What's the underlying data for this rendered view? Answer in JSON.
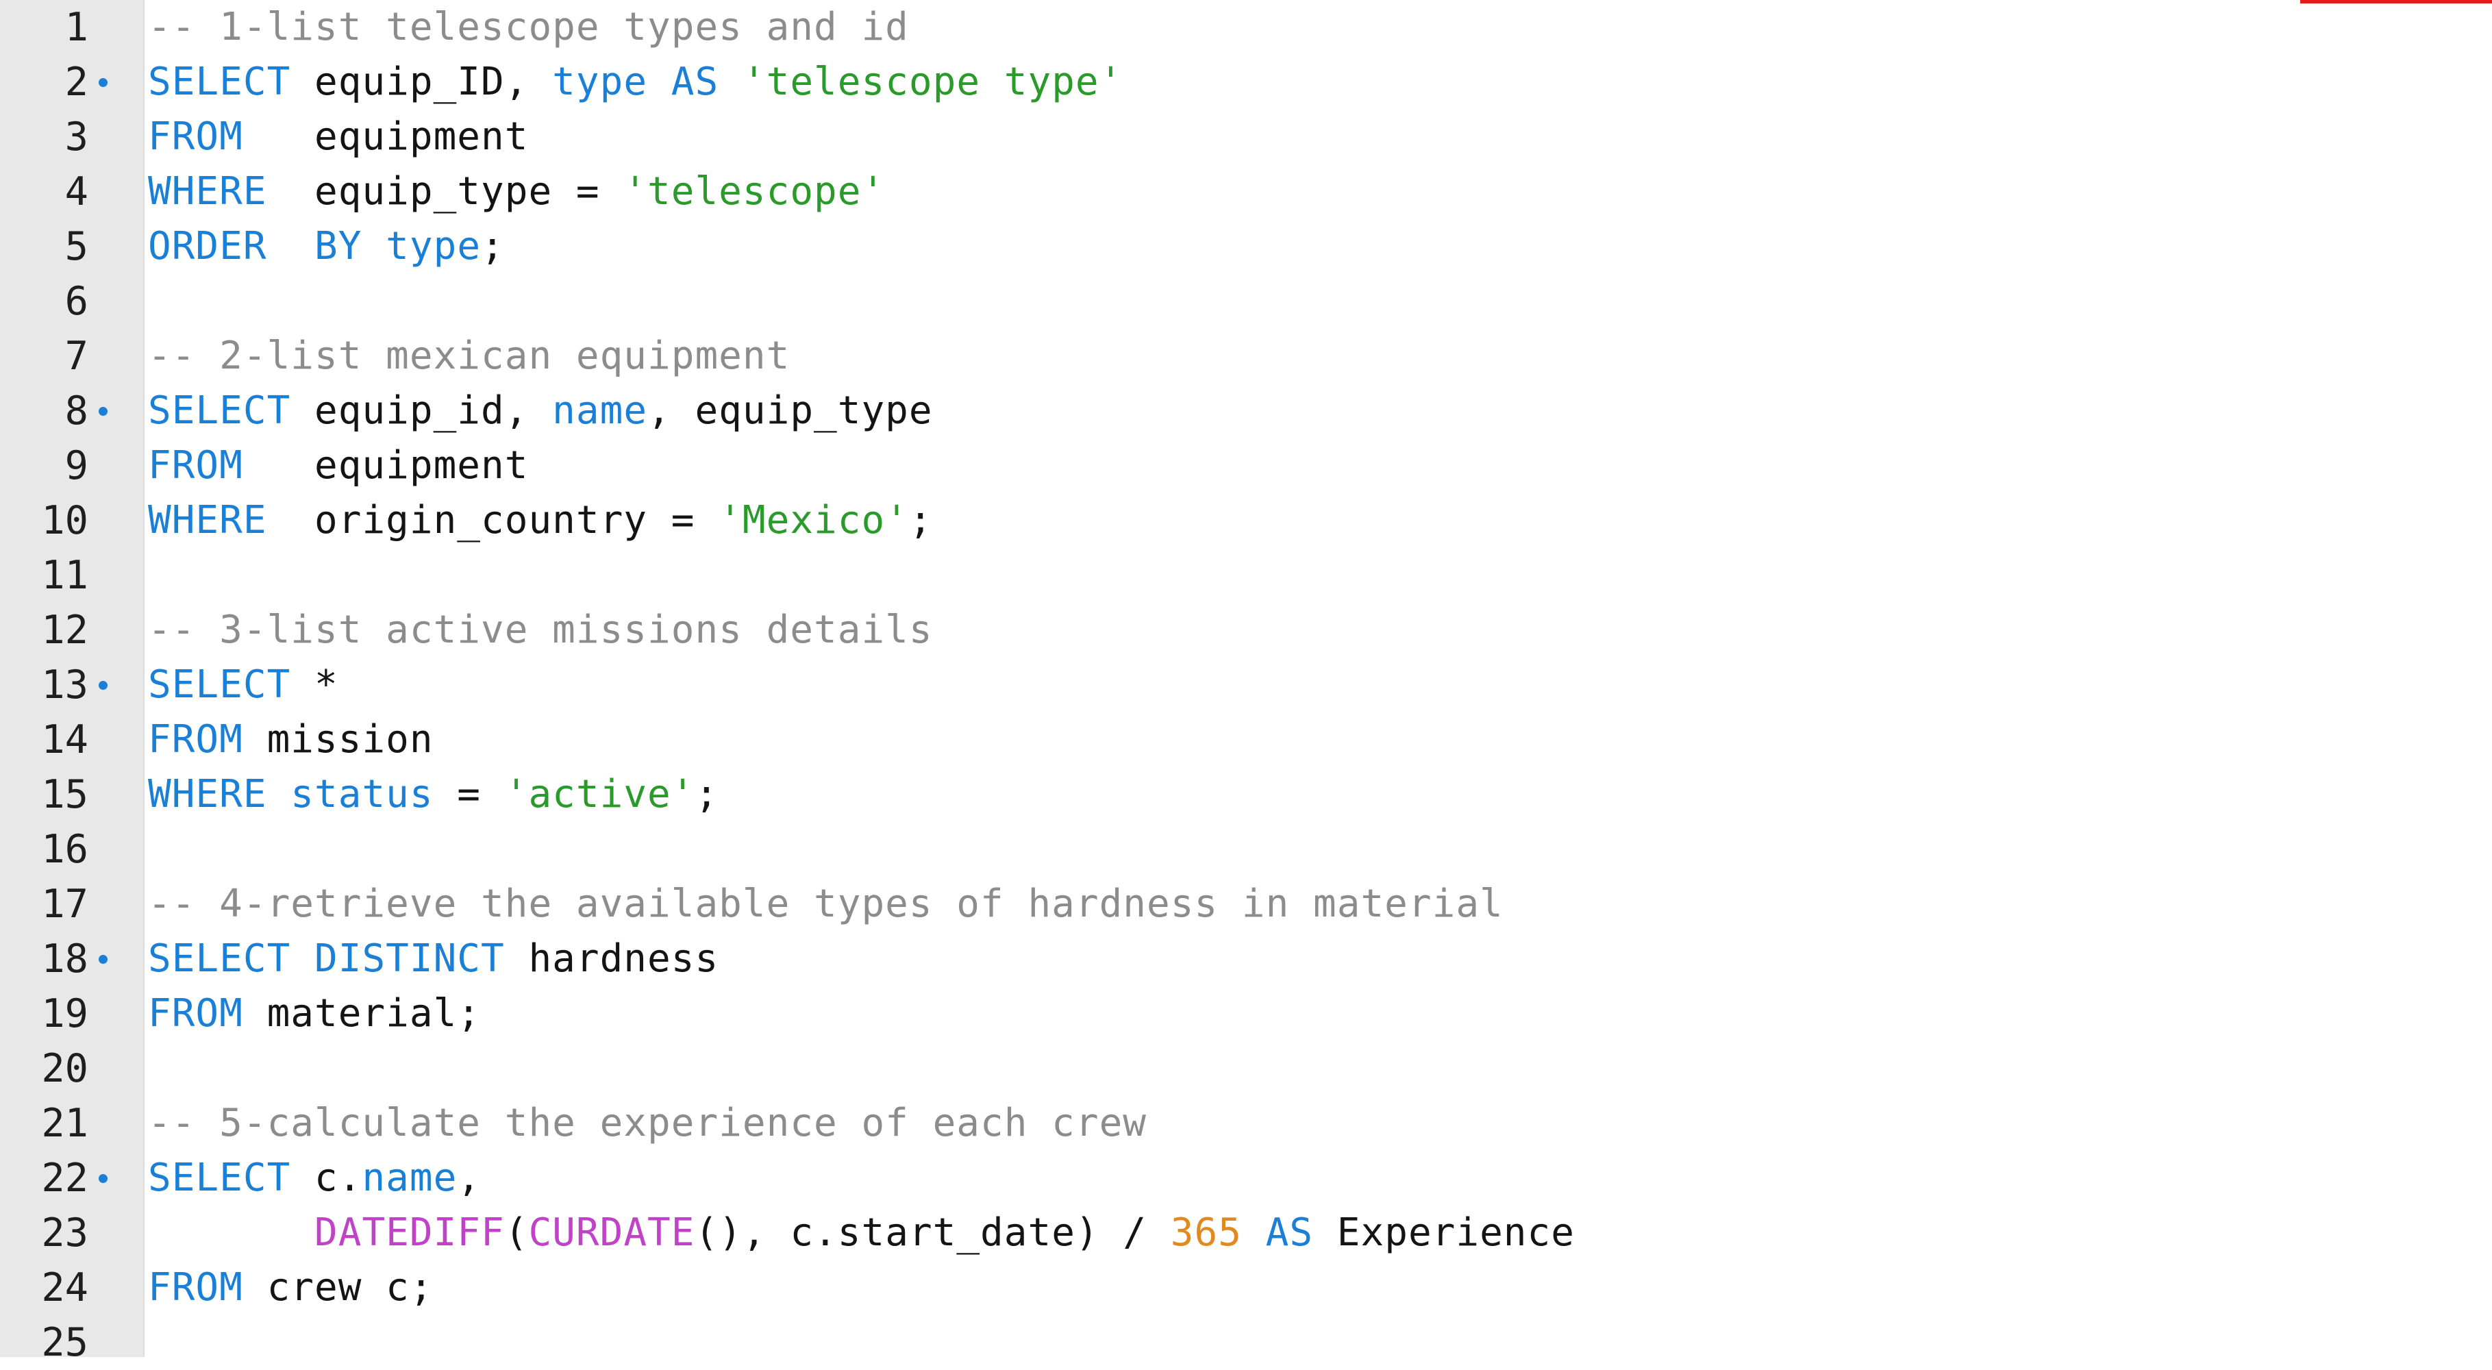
{
  "editor": {
    "fold_marker_color": "#1a7fd6",
    "accent_marker_color": "#e81b1b",
    "lines": [
      {
        "number": "1",
        "fold": false,
        "tokens": [
          {
            "t": "comment",
            "v": "-- 1-list telescope types and id"
          }
        ]
      },
      {
        "number": "2",
        "fold": true,
        "tokens": [
          {
            "t": "keyword",
            "v": "SELECT"
          },
          {
            "t": "plain",
            "v": " equip_ID, "
          },
          {
            "t": "keyword",
            "v": "type"
          },
          {
            "t": "plain",
            "v": " "
          },
          {
            "t": "keyword",
            "v": "AS"
          },
          {
            "t": "plain",
            "v": " "
          },
          {
            "t": "string",
            "v": "'telescope type'"
          }
        ]
      },
      {
        "number": "3",
        "fold": false,
        "tokens": [
          {
            "t": "keyword",
            "v": "FROM"
          },
          {
            "t": "plain",
            "v": "   equipment"
          }
        ]
      },
      {
        "number": "4",
        "fold": false,
        "tokens": [
          {
            "t": "keyword",
            "v": "WHERE"
          },
          {
            "t": "plain",
            "v": "  equip_type = "
          },
          {
            "t": "string",
            "v": "'telescope'"
          }
        ]
      },
      {
        "number": "5",
        "fold": false,
        "tokens": [
          {
            "t": "keyword",
            "v": "ORDER"
          },
          {
            "t": "plain",
            "v": "  "
          },
          {
            "t": "keyword",
            "v": "BY"
          },
          {
            "t": "plain",
            "v": " "
          },
          {
            "t": "keyword",
            "v": "type"
          },
          {
            "t": "plain",
            "v": ";"
          }
        ]
      },
      {
        "number": "6",
        "fold": false,
        "tokens": []
      },
      {
        "number": "7",
        "fold": false,
        "tokens": [
          {
            "t": "comment",
            "v": "-- 2-list mexican equipment"
          }
        ]
      },
      {
        "number": "8",
        "fold": true,
        "tokens": [
          {
            "t": "keyword",
            "v": "SELECT"
          },
          {
            "t": "plain",
            "v": " equip_id, "
          },
          {
            "t": "keyword",
            "v": "name"
          },
          {
            "t": "plain",
            "v": ", equip_type"
          }
        ]
      },
      {
        "number": "9",
        "fold": false,
        "tokens": [
          {
            "t": "keyword",
            "v": "FROM"
          },
          {
            "t": "plain",
            "v": "   equipment"
          }
        ]
      },
      {
        "number": "10",
        "fold": false,
        "tokens": [
          {
            "t": "keyword",
            "v": "WHERE"
          },
          {
            "t": "plain",
            "v": "  origin_country = "
          },
          {
            "t": "string",
            "v": "'Mexico'"
          },
          {
            "t": "plain",
            "v": ";"
          }
        ]
      },
      {
        "number": "11",
        "fold": false,
        "tokens": []
      },
      {
        "number": "12",
        "fold": false,
        "tokens": [
          {
            "t": "comment",
            "v": "-- 3-list active missions details"
          }
        ]
      },
      {
        "number": "13",
        "fold": true,
        "tokens": [
          {
            "t": "keyword",
            "v": "SELECT"
          },
          {
            "t": "plain",
            "v": " *"
          }
        ]
      },
      {
        "number": "14",
        "fold": false,
        "tokens": [
          {
            "t": "keyword",
            "v": "FROM"
          },
          {
            "t": "plain",
            "v": " mission"
          }
        ]
      },
      {
        "number": "15",
        "fold": false,
        "tokens": [
          {
            "t": "keyword",
            "v": "WHERE"
          },
          {
            "t": "plain",
            "v": " "
          },
          {
            "t": "keyword",
            "v": "status"
          },
          {
            "t": "plain",
            "v": " = "
          },
          {
            "t": "string",
            "v": "'active'"
          },
          {
            "t": "plain",
            "v": ";"
          }
        ]
      },
      {
        "number": "16",
        "fold": false,
        "tokens": []
      },
      {
        "number": "17",
        "fold": false,
        "tokens": [
          {
            "t": "comment",
            "v": "-- 4-retrieve the available types of hardness in material"
          }
        ]
      },
      {
        "number": "18",
        "fold": true,
        "tokens": [
          {
            "t": "keyword",
            "v": "SELECT"
          },
          {
            "t": "plain",
            "v": " "
          },
          {
            "t": "keyword",
            "v": "DISTINCT"
          },
          {
            "t": "plain",
            "v": " hardness"
          }
        ]
      },
      {
        "number": "19",
        "fold": false,
        "tokens": [
          {
            "t": "keyword",
            "v": "FROM"
          },
          {
            "t": "plain",
            "v": " material;"
          }
        ]
      },
      {
        "number": "20",
        "fold": false,
        "tokens": []
      },
      {
        "number": "21",
        "fold": false,
        "tokens": [
          {
            "t": "comment",
            "v": "-- 5-calculate the experience of each crew"
          }
        ]
      },
      {
        "number": "22",
        "fold": true,
        "tokens": [
          {
            "t": "keyword",
            "v": "SELECT"
          },
          {
            "t": "plain",
            "v": " c."
          },
          {
            "t": "keyword",
            "v": "name"
          },
          {
            "t": "plain",
            "v": ","
          }
        ]
      },
      {
        "number": "23",
        "fold": false,
        "tokens": [
          {
            "t": "plain",
            "v": "       "
          },
          {
            "t": "function",
            "v": "DATEDIFF"
          },
          {
            "t": "plain",
            "v": "("
          },
          {
            "t": "function",
            "v": "CURDATE"
          },
          {
            "t": "plain",
            "v": "(), c.start_date) / "
          },
          {
            "t": "number",
            "v": "365"
          },
          {
            "t": "plain",
            "v": " "
          },
          {
            "t": "keyword",
            "v": "AS"
          },
          {
            "t": "plain",
            "v": " Experience"
          }
        ]
      },
      {
        "number": "24",
        "fold": false,
        "tokens": [
          {
            "t": "keyword",
            "v": "FROM"
          },
          {
            "t": "plain",
            "v": " crew c;"
          }
        ]
      },
      {
        "number": "25",
        "fold": false,
        "tokens": []
      }
    ]
  }
}
